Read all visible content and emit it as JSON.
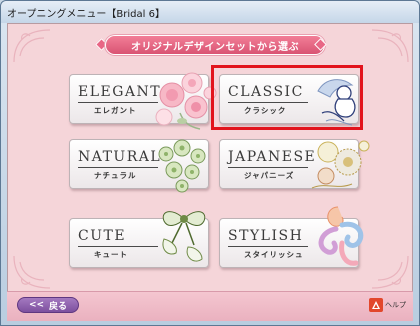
{
  "window": {
    "title": "オープニングメニュー【Bridal 6】"
  },
  "heading": "オリジナルデザインセットから選ぶ",
  "cards": [
    {
      "title": "ELEGANT",
      "subtitle": "エレガント"
    },
    {
      "title": "CLASSIC",
      "subtitle": "クラシック",
      "selected": true
    },
    {
      "title": "NATURAL",
      "subtitle": "ナチュラル"
    },
    {
      "title": "JAPANESE",
      "subtitle": "ジャパニーズ"
    },
    {
      "title": "CUTE",
      "subtitle": "キュート"
    },
    {
      "title": "STYLISH",
      "subtitle": "スタイリッシュ"
    }
  ],
  "footer": {
    "back_label": "戻る",
    "back_icon": "<<",
    "help_label": "ヘルプ"
  },
  "colors": {
    "background": "#f5d5d9",
    "heading": "#e0607d",
    "selection": "#e2141d",
    "back_button": "#8e5fae"
  }
}
